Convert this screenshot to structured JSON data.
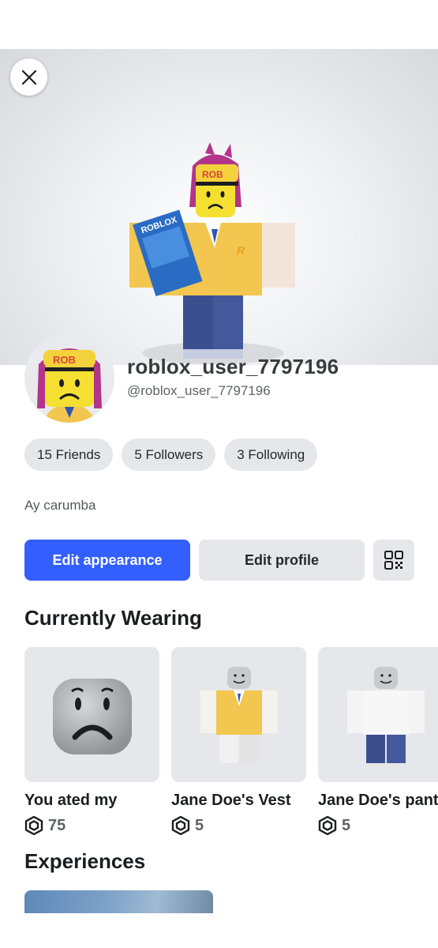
{
  "profile": {
    "display_name": "roblox_user_7797196",
    "username": "@roblox_user_7797196",
    "bio": "Ay carumba"
  },
  "stats": {
    "friends": "15 Friends",
    "followers": "5 Followers",
    "following": "3 Following"
  },
  "actions": {
    "edit_appearance": "Edit appearance",
    "edit_profile": "Edit profile"
  },
  "sections": {
    "currently_wearing": "Currently Wearing",
    "experiences": "Experiences"
  },
  "items": [
    {
      "name": "You ated my",
      "price": "75"
    },
    {
      "name": "Jane Doe's Vest",
      "price": "5"
    },
    {
      "name": "Jane Doe's pant",
      "price": "5"
    }
  ],
  "colors": {
    "primary": "#335fff",
    "pill_bg": "#e6e7ea",
    "vest": "#f2c64f",
    "hair": "#b2358a",
    "pants": "#3b4f8f"
  },
  "icons": {
    "close": "close-icon",
    "qr": "qr-code-icon",
    "robux": "robux-icon"
  }
}
